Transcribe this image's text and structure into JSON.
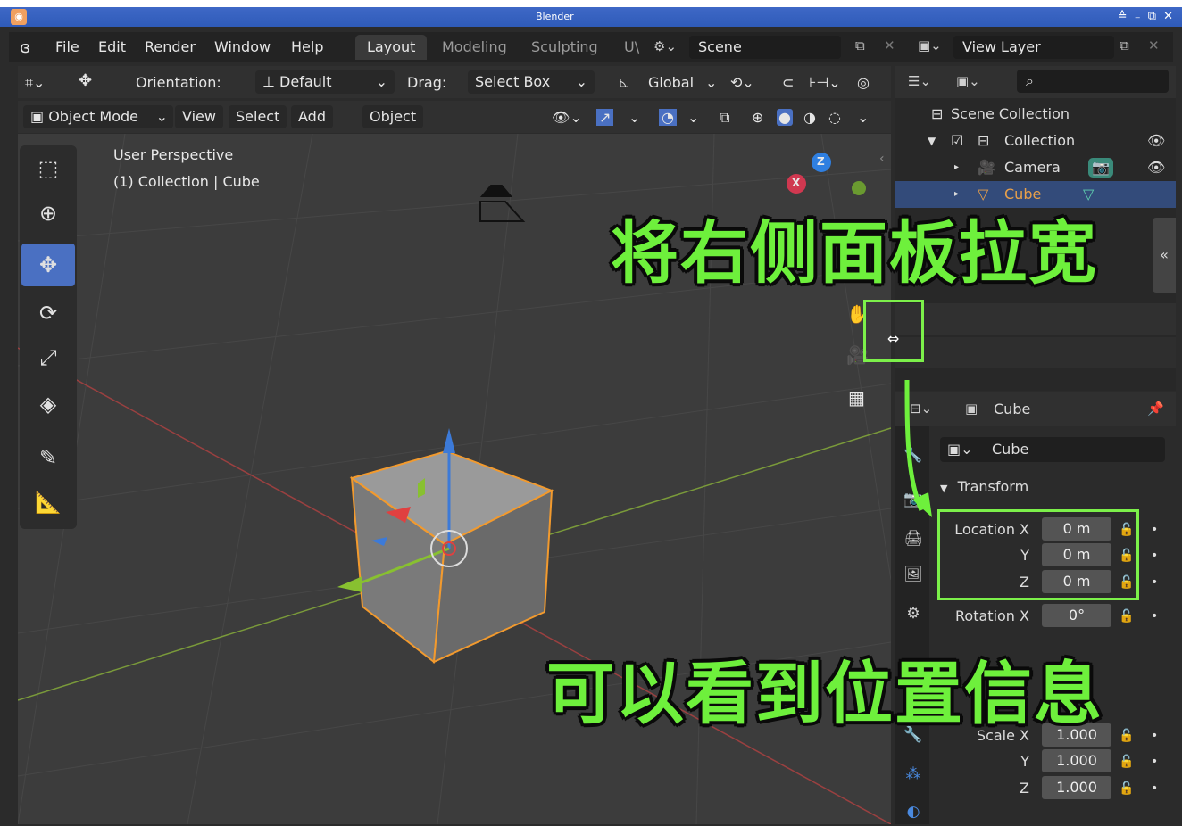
{
  "window": {
    "title": "Blender",
    "controls": "≙ ₋ ⧉ ✕"
  },
  "menu": {
    "items": [
      "File",
      "Edit",
      "Render",
      "Window",
      "Help"
    ]
  },
  "workspaces": [
    "Layout",
    "Modeling",
    "Sculpting",
    "U\\"
  ],
  "scene": {
    "label": "Scene"
  },
  "view_layer": {
    "label": "View Layer"
  },
  "header1": {
    "orientation_label": "Orientation:",
    "orientation_value": "Default",
    "drag_label": "Drag:",
    "drag_value": "Select Box",
    "transform_space": "Global"
  },
  "header2": {
    "mode": "Object Mode",
    "menus": [
      "View",
      "Select",
      "Add",
      "Object"
    ]
  },
  "viewport": {
    "perspective": "User Perspective",
    "context": "(1) Collection | Cube",
    "gizmo_labels": {
      "z": "Z",
      "x": "X"
    }
  },
  "outliner": {
    "rows": [
      {
        "label": "Scene Collection",
        "icon": "collection-icon"
      },
      {
        "label": "Collection",
        "icon": "collection-icon"
      },
      {
        "label": "Camera",
        "icon": "camera-icon"
      },
      {
        "label": "Cube",
        "icon": "mesh-icon"
      }
    ]
  },
  "properties": {
    "object_name": "Cube",
    "data_name": "Cube",
    "panel": "Transform",
    "location": {
      "label_x": "Location X",
      "label_y": "Y",
      "label_z": "Z",
      "x": "0 m",
      "y": "0 m",
      "z": "0 m"
    },
    "rotation": {
      "label_x": "Rotation X",
      "x": "0°"
    },
    "scale": {
      "label_x": "Scale X",
      "label_y": "Y",
      "label_z": "Z",
      "x": "1.000",
      "y": "1.000",
      "z": "1.000"
    }
  },
  "annotations": {
    "top": "将右侧面板拉宽",
    "bottom": "可以看到位置信息"
  },
  "colors": {
    "accent": "#4a70c2",
    "selection": "#ff9a2a",
    "annotation": "#6ef03c"
  }
}
